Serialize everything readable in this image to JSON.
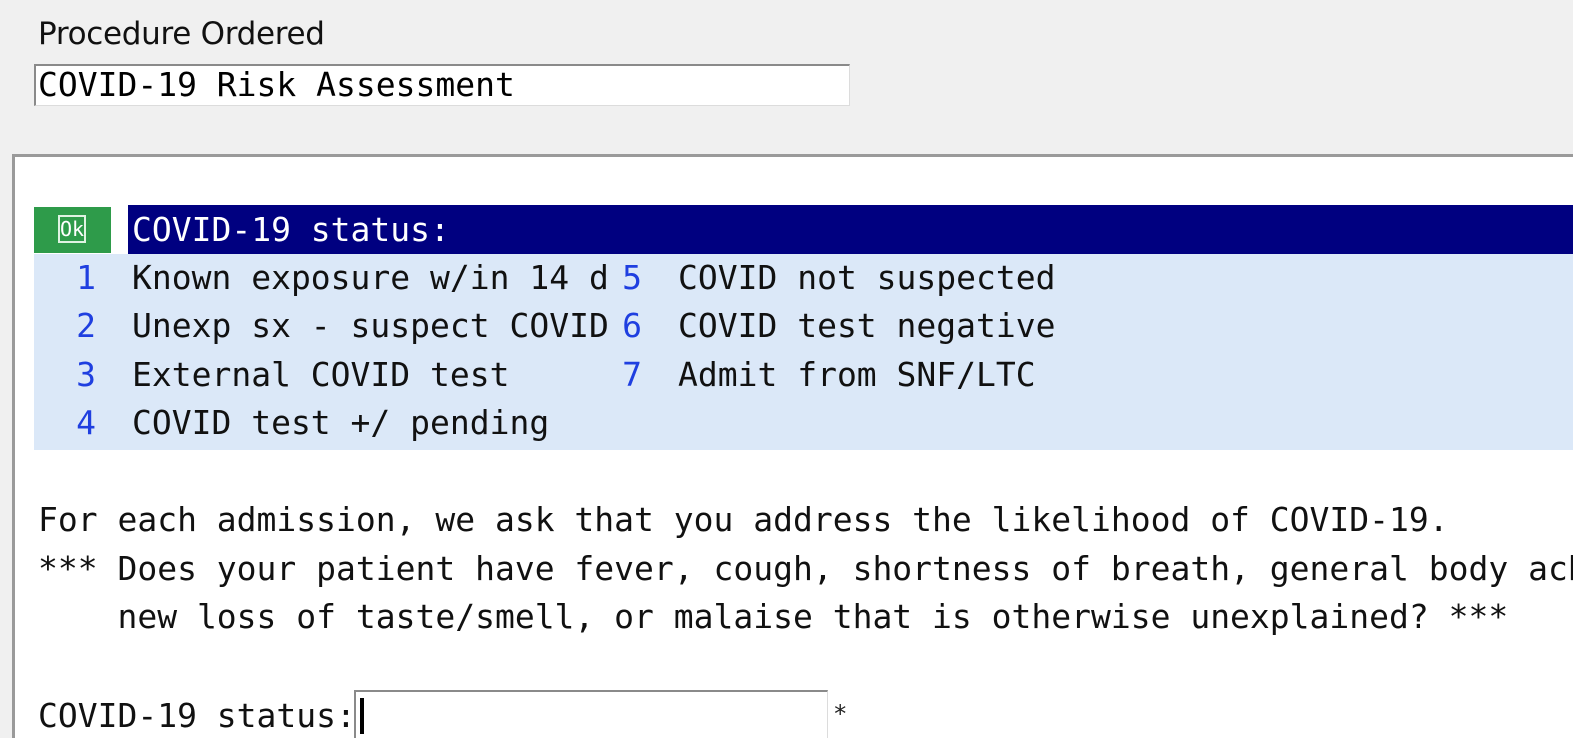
{
  "procedure": {
    "label": "Procedure Ordered",
    "value": "COVID-19 Risk Assessment"
  },
  "prompt": {
    "ok_icon": "ok-check-icon",
    "ok_text": "Ok",
    "title": "COVID-19 status:"
  },
  "options": [
    {
      "num": "1",
      "text": "Known exposure w/in 14 d"
    },
    {
      "num": "2",
      "text": "Unexp sx - suspect COVID"
    },
    {
      "num": "3",
      "text": "External COVID test"
    },
    {
      "num": "4",
      "text": "COVID test +/ pending"
    },
    {
      "num": "5",
      "text": "COVID not suspected"
    },
    {
      "num": "6",
      "text": "COVID test negative"
    },
    {
      "num": "7",
      "text": "Admit from SNF/LTC"
    }
  ],
  "message": {
    "line1": "For each admission, we ask that you address the likelihood of COVID-19.",
    "line2": "*** Does your patient have fever, cough, shortness of breath, general body aches,",
    "line3": "    new loss of taste/smell, or malaise that is otherwise unexplained? ***"
  },
  "status_field": {
    "label": "COVID-19 status:",
    "value": "",
    "required_mark": "*"
  },
  "colors": {
    "title_bar": "#000080",
    "ok_icon": "#2e9b4a",
    "options_bg": "#dbe8f8",
    "option_number": "#1f3fe0"
  }
}
